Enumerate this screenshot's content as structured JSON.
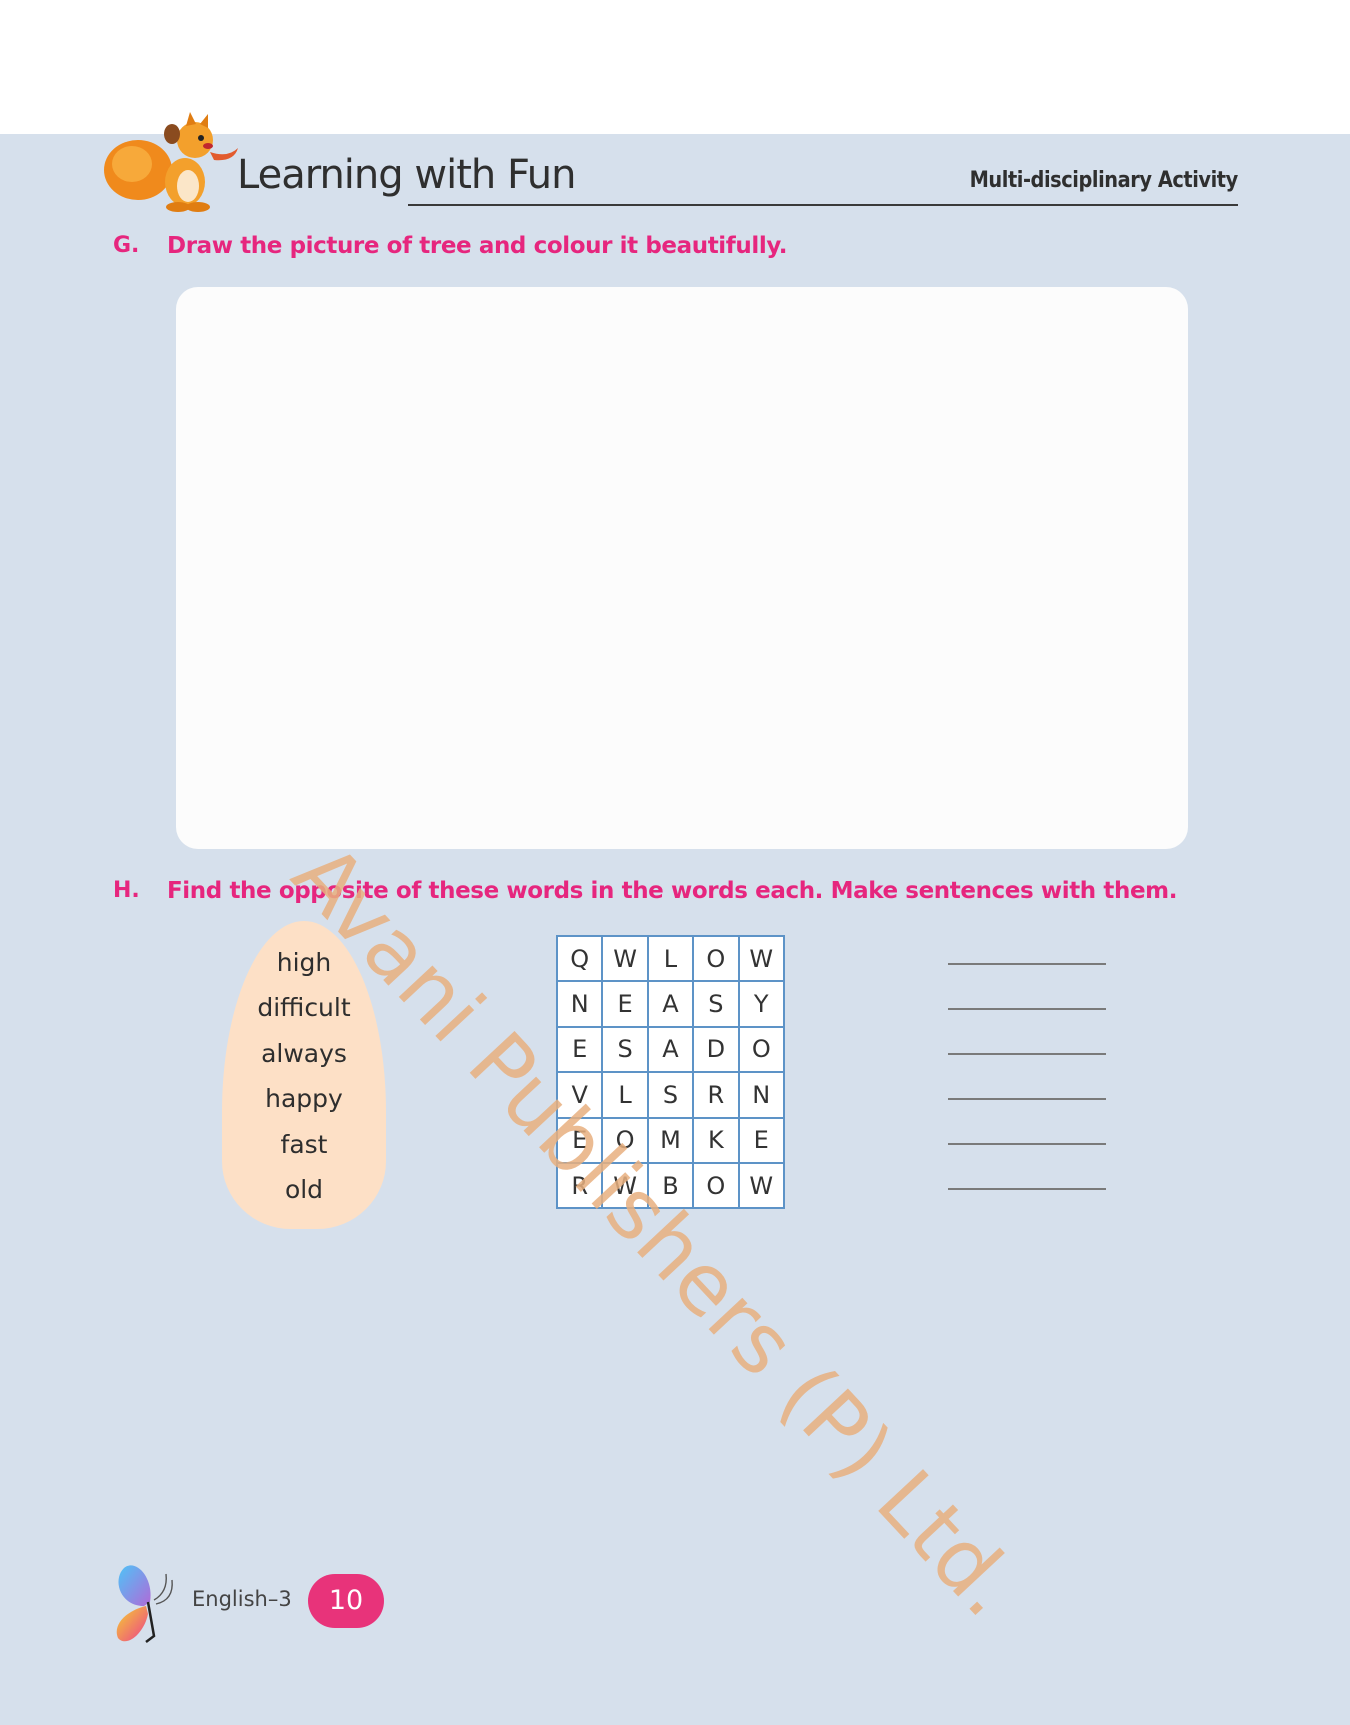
{
  "header": {
    "title": "Learning with Fun",
    "tag": "Multi-disciplinary Activity"
  },
  "questions": [
    {
      "letter": "G.",
      "text": "Draw the picture of tree and colour it beautifully."
    },
    {
      "letter": "H.",
      "text": "Find the opposite of these words in the words each. Make sentences with them."
    }
  ],
  "words": [
    "high",
    "difficult",
    "always",
    "happy",
    "fast",
    "old"
  ],
  "grid": [
    [
      "Q",
      "W",
      "L",
      "O",
      "W"
    ],
    [
      "N",
      "E",
      "A",
      "S",
      "Y"
    ],
    [
      "E",
      "S",
      "A",
      "D",
      "O"
    ],
    [
      "V",
      "L",
      "S",
      "R",
      "N"
    ],
    [
      "E",
      "O",
      "M",
      "K",
      "E"
    ],
    [
      "R",
      "W",
      "B",
      "O",
      "W"
    ]
  ],
  "watermark": "Avani Publishers (P) Ltd.",
  "footer": {
    "book": "English–3",
    "page": "10"
  },
  "colors": {
    "accent": "#e6267e",
    "background": "#d6e0ec",
    "grid_border": "#5d93c7",
    "word_blob": "#fde0c6",
    "watermark": "#e8b07f"
  },
  "icons": [
    "squirrel-mascot-icon",
    "butterfly-logo-icon"
  ]
}
